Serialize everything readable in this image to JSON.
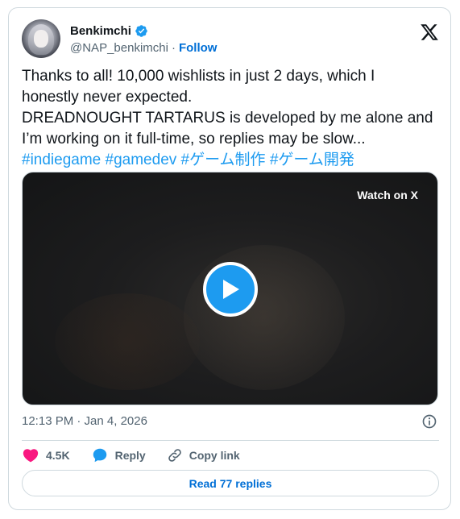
{
  "author": {
    "name": "Benkimchi",
    "handle": "@NAP_benkimchi",
    "separator": "·",
    "follow_label": "Follow"
  },
  "tweet": {
    "line1": "Thanks to all! 10,000 wishlists in just 2 days, which I",
    "line2": "honestly never expected.",
    "line3": "DREADNOUGHT TARTARUS is developed by me alone and",
    "line4": "I’m working on it full-time, so replies may be slow...",
    "hashtags": [
      "#indiegame",
      "#gamedev",
      "#ゲーム制作",
      "#ゲーム開発"
    ]
  },
  "media": {
    "watch_label": "Watch on X"
  },
  "meta": {
    "timestamp": "12:13 PM · Jan 4, 2026"
  },
  "actions": {
    "likes": "4.5K",
    "reply_label": "Reply",
    "copy_link_label": "Copy link"
  },
  "read_replies_label": "Read 77 replies",
  "icons": [
    "verified-badge-icon",
    "x-logo-icon",
    "play-icon",
    "info-icon",
    "heart-icon",
    "reply-bubble-icon",
    "link-icon"
  ],
  "colors": {
    "link": "#1d9bf0",
    "follow": "#006fd6",
    "heart": "#f91880",
    "muted": "#536471"
  }
}
